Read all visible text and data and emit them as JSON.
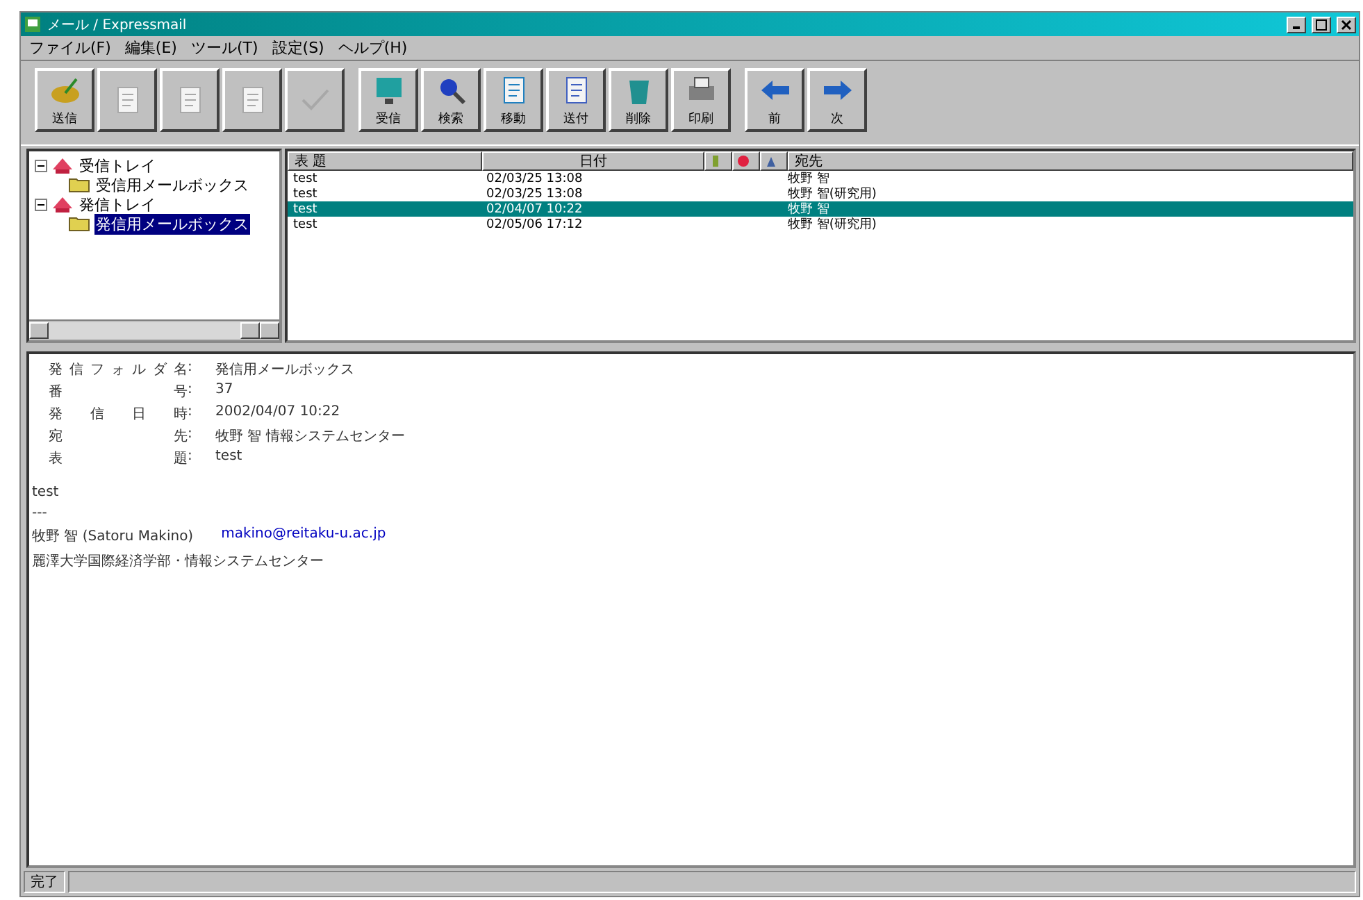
{
  "window": {
    "title": "メール / Expressmail"
  },
  "menu": [
    "ファイル(F)",
    "編集(E)",
    "ツール(T)",
    "設定(S)",
    "ヘルプ(H)"
  ],
  "toolbar": [
    [
      {
        "label": "送信",
        "disabled": false
      },
      {
        "disabled": true
      },
      {
        "disabled": true
      },
      {
        "disabled": true
      },
      {
        "disabled": true
      }
    ],
    [
      {
        "label": "受信",
        "disabled": false
      },
      {
        "label": "検索",
        "disabled": false
      },
      {
        "label": "移動",
        "disabled": false
      },
      {
        "label": "送付",
        "disabled": false
      },
      {
        "label": "削除",
        "disabled": false
      },
      {
        "label": "印刷",
        "disabled": false
      }
    ],
    [
      {
        "label": "前",
        "disabled": false
      },
      {
        "label": "次",
        "disabled": false
      }
    ]
  ],
  "tree": [
    {
      "label": "受信トレイ",
      "expanded": true,
      "selected": false,
      "children": [
        {
          "label": "受信用メールボックス",
          "selected": false
        }
      ]
    },
    {
      "label": "発信トレイ",
      "expanded": true,
      "selected": false,
      "children": [
        {
          "label": "発信用メールボックス",
          "selected": true
        }
      ]
    }
  ],
  "table": {
    "columns": [
      "表 題",
      "日付",
      "宛先"
    ],
    "rows": [
      {
        "subject": "test",
        "date": "02/03/25 13:08",
        "to": "牧野 智",
        "selected": false
      },
      {
        "subject": "test",
        "date": "02/03/25 13:08",
        "to": "牧野 智(研究用)",
        "selected": false
      },
      {
        "subject": "test",
        "date": "02/04/07 10:22",
        "to": "牧野 智",
        "selected": true
      },
      {
        "subject": "test",
        "date": "02/05/06 17:12",
        "to": "牧野 智(研究用)",
        "selected": false
      }
    ]
  },
  "message": {
    "fields": [
      {
        "label": "発信フォルダ名",
        "separator": ":",
        "value": "発信用メールボックス"
      },
      {
        "label": "番 号",
        "separator": ":",
        "value": "37"
      },
      {
        "label": "発 信 日 時",
        "separator": ":",
        "value": "2002/04/07 10:22"
      },
      {
        "label": "宛 先",
        "separator": ":",
        "value": "牧野 智 情報システムセンター"
      },
      {
        "label": "表 題",
        "separator": ":",
        "value": "test"
      }
    ],
    "body": [
      "test",
      "---"
    ],
    "signature_name": "牧野 智 (Satoru Makino)",
    "signature_email": "makino@reitaku-u.ac.jp",
    "signature_org": "麗澤大学国際経済学部・情報システムセンター"
  },
  "status_bar": "完了"
}
